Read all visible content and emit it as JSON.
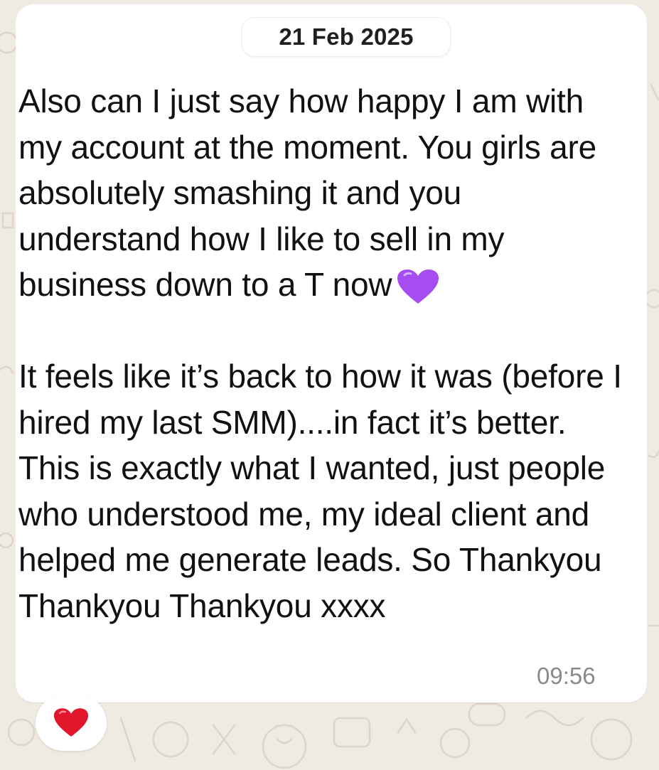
{
  "date_separator": "21 Feb 2025",
  "message": {
    "paragraph_1": "Also can I just say how happy I am with my account at the moment. You girls are absolutely smashing it and you understand how I like to sell in my business down to a T now",
    "paragraph_1_emoji": "purple-heart-icon",
    "paragraph_2": "It feels like it’s back to how it was (before I hired my last SMM)....in fact it’s better. This is exactly what I wanted, just people who understood me, my ideal client and helped me generate leads. So Thankyou Thankyou Thankyou xxxx",
    "time": "09:56"
  },
  "reaction": {
    "emoji": "red-heart-icon"
  },
  "colors": {
    "wallpaper": "#efeae2",
    "bubble": "#ffffff",
    "timestamp": "#8a8a8a",
    "purple_heart": "#a64df2",
    "red_heart": "#e0162b"
  }
}
